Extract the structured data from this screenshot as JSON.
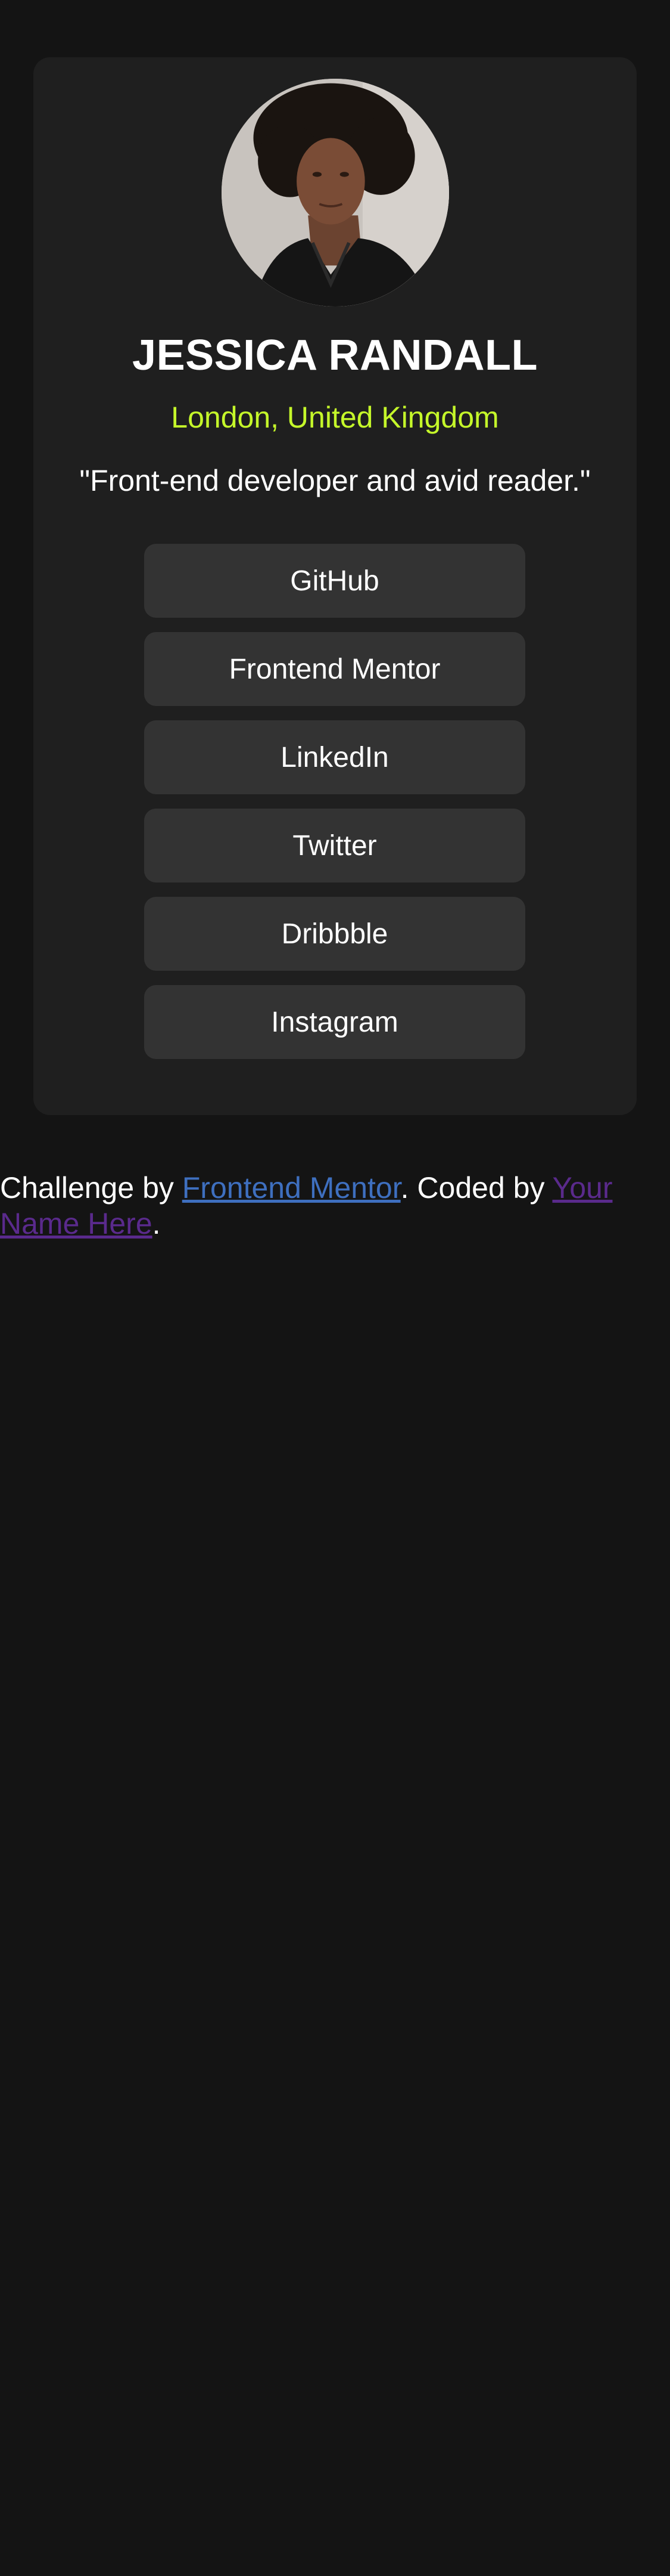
{
  "colors": {
    "page_background": "#141414",
    "card_background": "#1f1f1f",
    "button_background": "#333333",
    "accent_location": "#c5f82a",
    "link_primary": "#3e6fbf",
    "link_visited": "#5a2a8c"
  },
  "profile": {
    "name": "JESSICA RANDALL",
    "location": "London, United Kingdom",
    "bio": "\"Front-end developer and avid reader.\""
  },
  "links": [
    {
      "label": "GitHub"
    },
    {
      "label": "Frontend Mentor"
    },
    {
      "label": "LinkedIn"
    },
    {
      "label": "Twitter"
    },
    {
      "label": "Dribbble"
    },
    {
      "label": "Instagram"
    }
  ],
  "attribution": {
    "prefix": "Challenge by ",
    "challenge_link": "Frontend Mentor",
    "middle": ". Coded by ",
    "author_link": "Your Name Here",
    "suffix": "."
  }
}
